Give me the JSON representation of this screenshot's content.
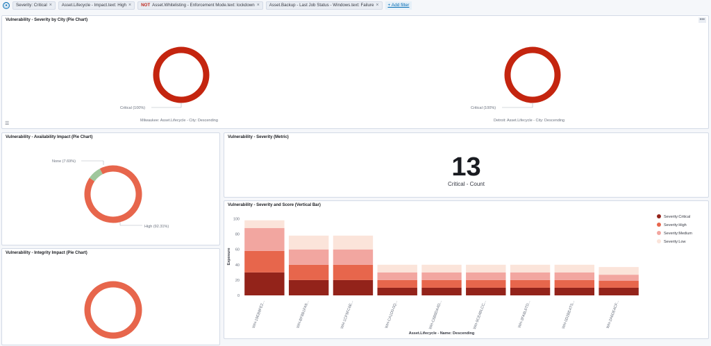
{
  "filters": {
    "items": [
      {
        "negate": "",
        "label": "Severity: Critical"
      },
      {
        "negate": "",
        "label": "Asset.Lifecycle - Impact.text: High"
      },
      {
        "negate": "NOT",
        "label": "Asset.Whitelisting - Enforcement Mode.text: lockdown"
      },
      {
        "negate": "",
        "label": "Asset.Backup - Last Job Status - Windows.text: Failure"
      }
    ],
    "add_label": "+ Add filter"
  },
  "panels": {
    "city": {
      "title": "Vulnerability - Severity by City (Pie Chart)",
      "menu": "•••",
      "charts": [
        {
          "slice_label": "Critical (100%)",
          "caption": "Milwaukee: Asset.Lifecycle - City: Descending"
        },
        {
          "slice_label": "Critical (100%)",
          "caption": "Detroit: Asset.Lifecycle - City: Descending"
        }
      ]
    },
    "availability": {
      "title": "Vulnerability - Availability Impact (Pie Chart)",
      "slices": [
        {
          "label": "High (92.31%)",
          "value": 92.31,
          "color": "#e7664c"
        },
        {
          "label": "None (7.69%)",
          "value": 7.69,
          "color": "#9fc79c"
        }
      ]
    },
    "metric": {
      "title": "Vulnerability - Severity (Metric)",
      "value": "13",
      "label": "Critical - Count"
    },
    "integrity": {
      "title": "Vulnerability - Integrity Impact (Pie Chart)"
    },
    "bar": {
      "title": "Vulnerability - Severity and Score (Vertical Bar)"
    }
  },
  "colors": {
    "critical": "#c4250f",
    "high": "#e7664c",
    "low_green": "#9fc79c"
  },
  "chart_data": {
    "type": "bar",
    "stacked": true,
    "categories": [
      "WH-19EB8FE2...",
      "WH-BF8B1FA9...",
      "WH-1CF9FC6E...",
      "WH-CA1D0-0Q...",
      "WH-C6B8DA4D...",
      "WH-9CE4BLCC...",
      "WH-3FA8L6TD...",
      "WH-0D2BE4TS...",
      "WH-2A6DE4CF..."
    ],
    "series": [
      {
        "name": "Severity:Critical",
        "color": "#93231a",
        "values": [
          30,
          20,
          20,
          10,
          10,
          10,
          10,
          10,
          10
        ]
      },
      {
        "name": "Severity:High",
        "color": "#e7664c",
        "values": [
          28,
          20,
          20,
          10,
          10,
          10,
          10,
          10,
          9
        ]
      },
      {
        "name": "Severity:Medium",
        "color": "#f2a6a0",
        "values": [
          30,
          20,
          20,
          10,
          10,
          10,
          10,
          10,
          8
        ]
      },
      {
        "name": "Severity:Low",
        "color": "#fbe4da",
        "values": [
          10,
          18,
          18,
          10,
          10,
          10,
          10,
          10,
          10
        ]
      }
    ],
    "yticks": [
      0,
      20,
      40,
      60,
      80,
      100
    ],
    "ylim": [
      0,
      105
    ],
    "xlabel": "Asset.Lifecycle - Name: Descending",
    "ylabel": "Exposure",
    "grid": false,
    "legend": "top-right"
  }
}
